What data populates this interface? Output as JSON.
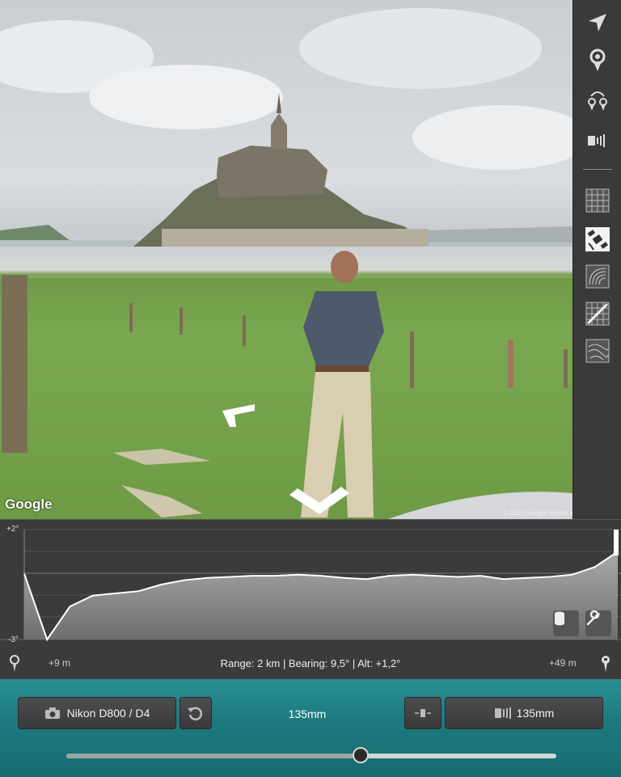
{
  "photo": {
    "attribution_logo": "Google",
    "copyright": "© 2017 Google   Report a problem"
  },
  "toolbar": {
    "items": [
      {
        "name": "location-arrow-icon"
      },
      {
        "name": "map-pin-icon"
      },
      {
        "name": "pin-pair-icon"
      },
      {
        "name": "camera-field-icon"
      },
      {
        "name": "grid-overlay-icon"
      },
      {
        "name": "satellite-icon"
      },
      {
        "name": "contour-icon"
      },
      {
        "name": "terrain-grid-icon"
      },
      {
        "name": "topo-icon"
      }
    ]
  },
  "profile": {
    "y_max_label": "+2°",
    "y_min_label": "-3°",
    "left_distance": "+9 m",
    "right_distance": "+49 m",
    "info": "Range: 2 km | Bearing: 9,5° | Alt: +1,2°",
    "elevation_angles": [
      0.0,
      -3.0,
      -1.5,
      -1.0,
      -0.9,
      -0.8,
      -0.5,
      -0.3,
      -0.2,
      -0.15,
      -0.1,
      -0.1,
      -0.05,
      -0.1,
      -0.2,
      -0.25,
      -0.1,
      -0.05,
      -0.1,
      -0.15,
      -0.1,
      -0.25,
      -0.2,
      -0.15,
      -0.05,
      0.3,
      1.0
    ]
  },
  "camera_bar": {
    "camera_label": "Nikon D800 / D4",
    "focal_length_display": "135mm",
    "lens_label": "135mm",
    "zoom_fraction": 0.6
  },
  "colors": {
    "accent": "#1d7b80",
    "panel": "#3a3a3a"
  }
}
